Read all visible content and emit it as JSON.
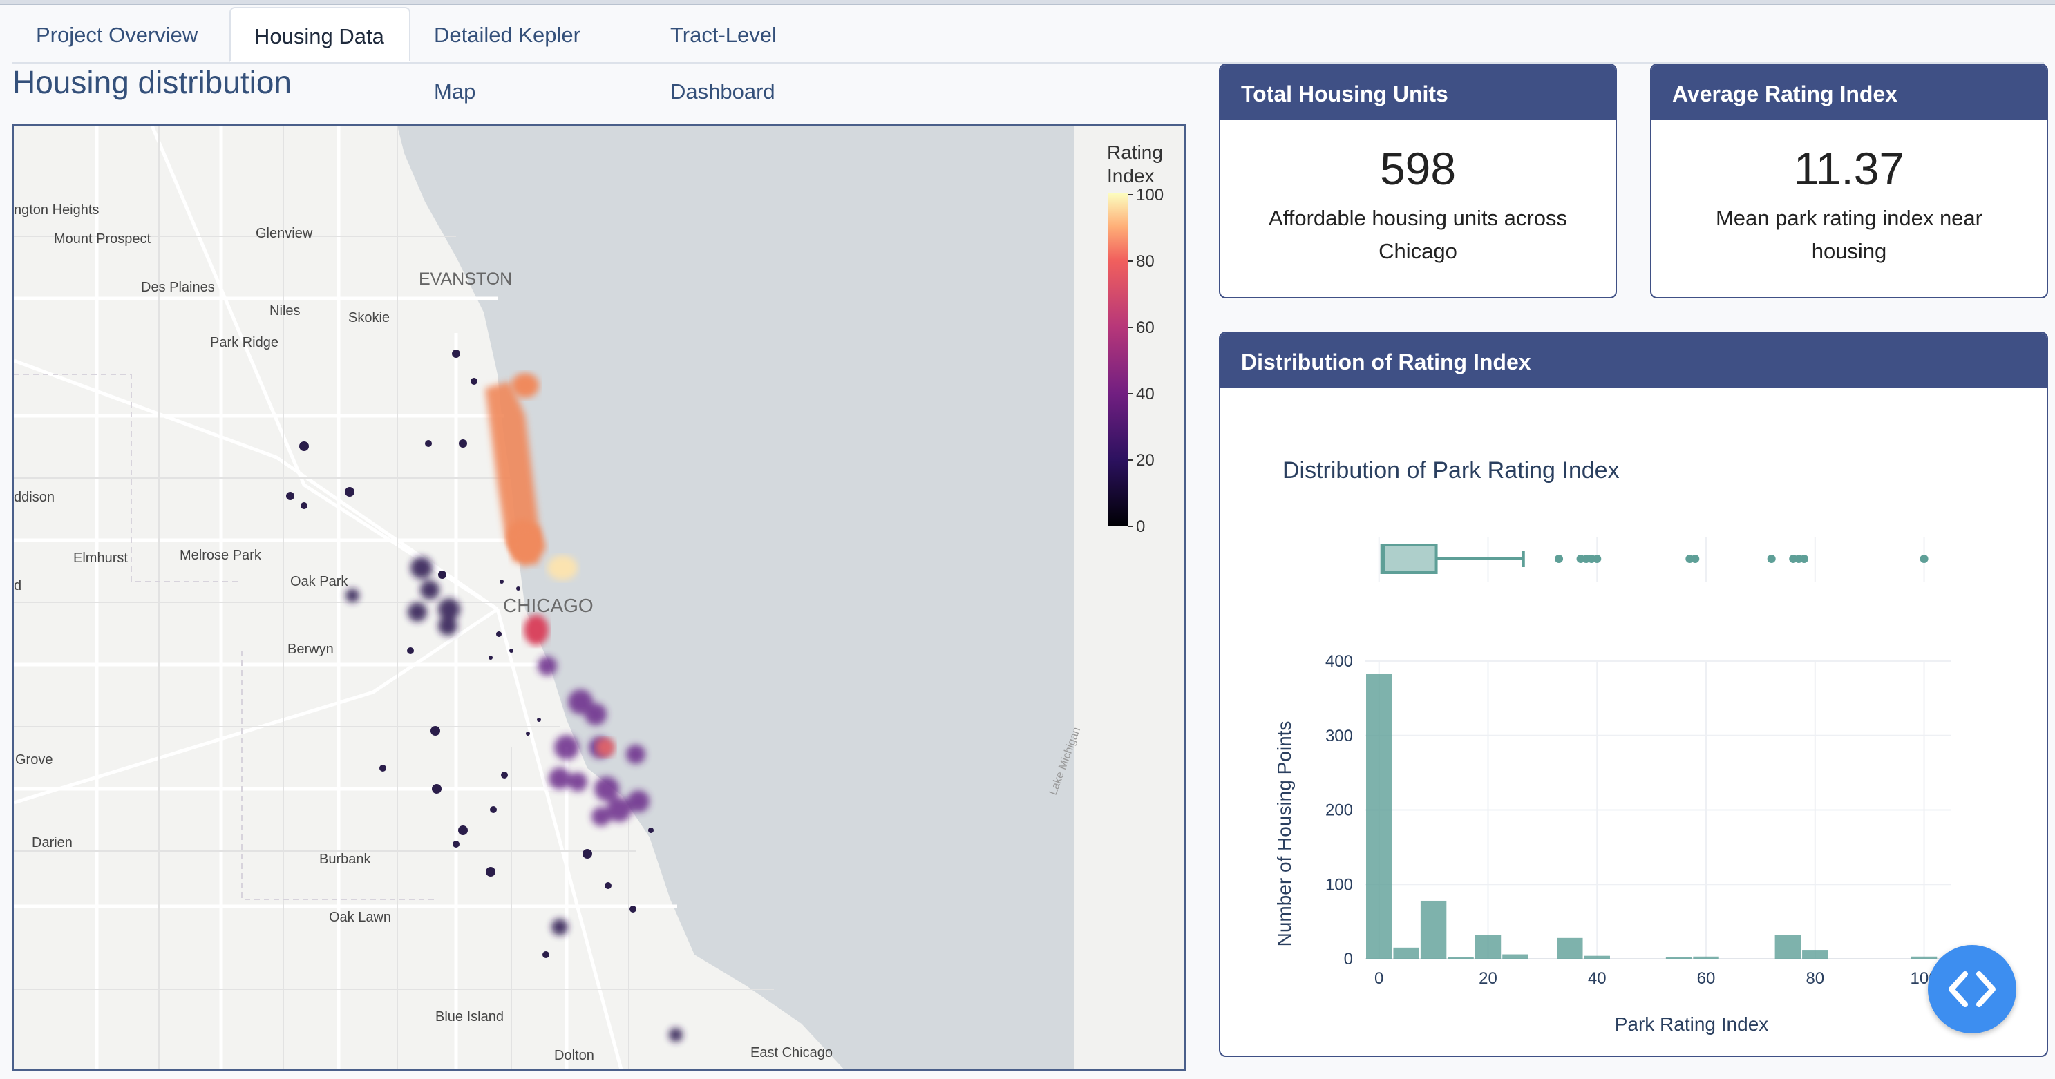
{
  "tabs": [
    {
      "label": "Project Overview",
      "active": false
    },
    {
      "label": "Housing Data",
      "active": true
    },
    {
      "label": "Detailed Kepler Map",
      "active": false
    },
    {
      "label": "Tract-Level Dashboard",
      "active": false
    }
  ],
  "page_title": "Housing distribution",
  "map": {
    "colorbar_title": "Rating Index",
    "colorbar_title_lines": [
      "Rating",
      "Index"
    ],
    "colorbar_ticks": [
      "100",
      "80",
      "60",
      "40",
      "20",
      "0"
    ],
    "place_labels": {
      "heights": "ngton Heights",
      "mount_prospect": "Mount Prospect",
      "glenview": "Glenview",
      "evanston": "EVANSTON",
      "des_plaines": "Des Plaines",
      "niles": "Niles",
      "skokie": "Skokie",
      "park_ridge": "Park Ridge",
      "addison": "ddison",
      "elmhurst": "Elmhurst",
      "melrose_park": "Melrose Park",
      "oak_park": "Oak Park",
      "chicago": "CHICAGO",
      "d": "d",
      "berwyn": "Berwyn",
      "grove": "Grove",
      "darien": "Darien",
      "burbank": "Burbank",
      "oak_lawn": "Oak Lawn",
      "blue_island": "Blue Island",
      "dolton": "Dolton",
      "east_chicago": "East Chicago",
      "lake_michigan": "Lake Michigan"
    }
  },
  "kpis": {
    "total": {
      "title": "Total Housing Units",
      "value": "598",
      "subtitle": "Affordable housing units across Chicago"
    },
    "average": {
      "title": "Average Rating Index",
      "value": "11.37",
      "subtitle": "Mean park rating index near housing"
    }
  },
  "distribution_card": {
    "title": "Distribution of Rating Index"
  },
  "colors": {
    "accent": "#3f5085",
    "teal": "#5e9f97",
    "button": "#3d8ef0"
  },
  "chart_data": {
    "type": "bar",
    "title": "Distribution of Park Rating Index",
    "xlabel": "Park Rating Index",
    "ylabel": "Number of Housing Points",
    "xlim": [
      -2.5,
      105
    ],
    "ylim": [
      0,
      400
    ],
    "x_ticks": [
      0,
      20,
      40,
      60,
      80,
      100
    ],
    "y_ticks": [
      0,
      100,
      200,
      300,
      400
    ],
    "bin_width": 5,
    "bins": [
      {
        "x0": -2.5,
        "count": 383
      },
      {
        "x0": 2.5,
        "count": 15
      },
      {
        "x0": 7.5,
        "count": 78
      },
      {
        "x0": 12.5,
        "count": 2
      },
      {
        "x0": 17.5,
        "count": 32
      },
      {
        "x0": 22.5,
        "count": 6
      },
      {
        "x0": 27.5,
        "count": 0
      },
      {
        "x0": 32.5,
        "count": 28
      },
      {
        "x0": 37.5,
        "count": 4
      },
      {
        "x0": 42.5,
        "count": 0
      },
      {
        "x0": 47.5,
        "count": 0
      },
      {
        "x0": 52.5,
        "count": 2
      },
      {
        "x0": 57.5,
        "count": 3
      },
      {
        "x0": 62.5,
        "count": 0
      },
      {
        "x0": 67.5,
        "count": 0
      },
      {
        "x0": 72.5,
        "count": 32
      },
      {
        "x0": 77.5,
        "count": 12
      },
      {
        "x0": 82.5,
        "count": 0
      },
      {
        "x0": 87.5,
        "count": 0
      },
      {
        "x0": 92.5,
        "count": 0
      },
      {
        "x0": 97.5,
        "count": 3
      }
    ],
    "boxplot": {
      "min": 0,
      "q1": 0.5,
      "median": 0.8,
      "q3": 10.5,
      "whisker_high": 26.5,
      "outliers": [
        33,
        37,
        38,
        39,
        40,
        57,
        58,
        72,
        76,
        77,
        78,
        100
      ]
    },
    "grid": true,
    "legend": "none"
  }
}
